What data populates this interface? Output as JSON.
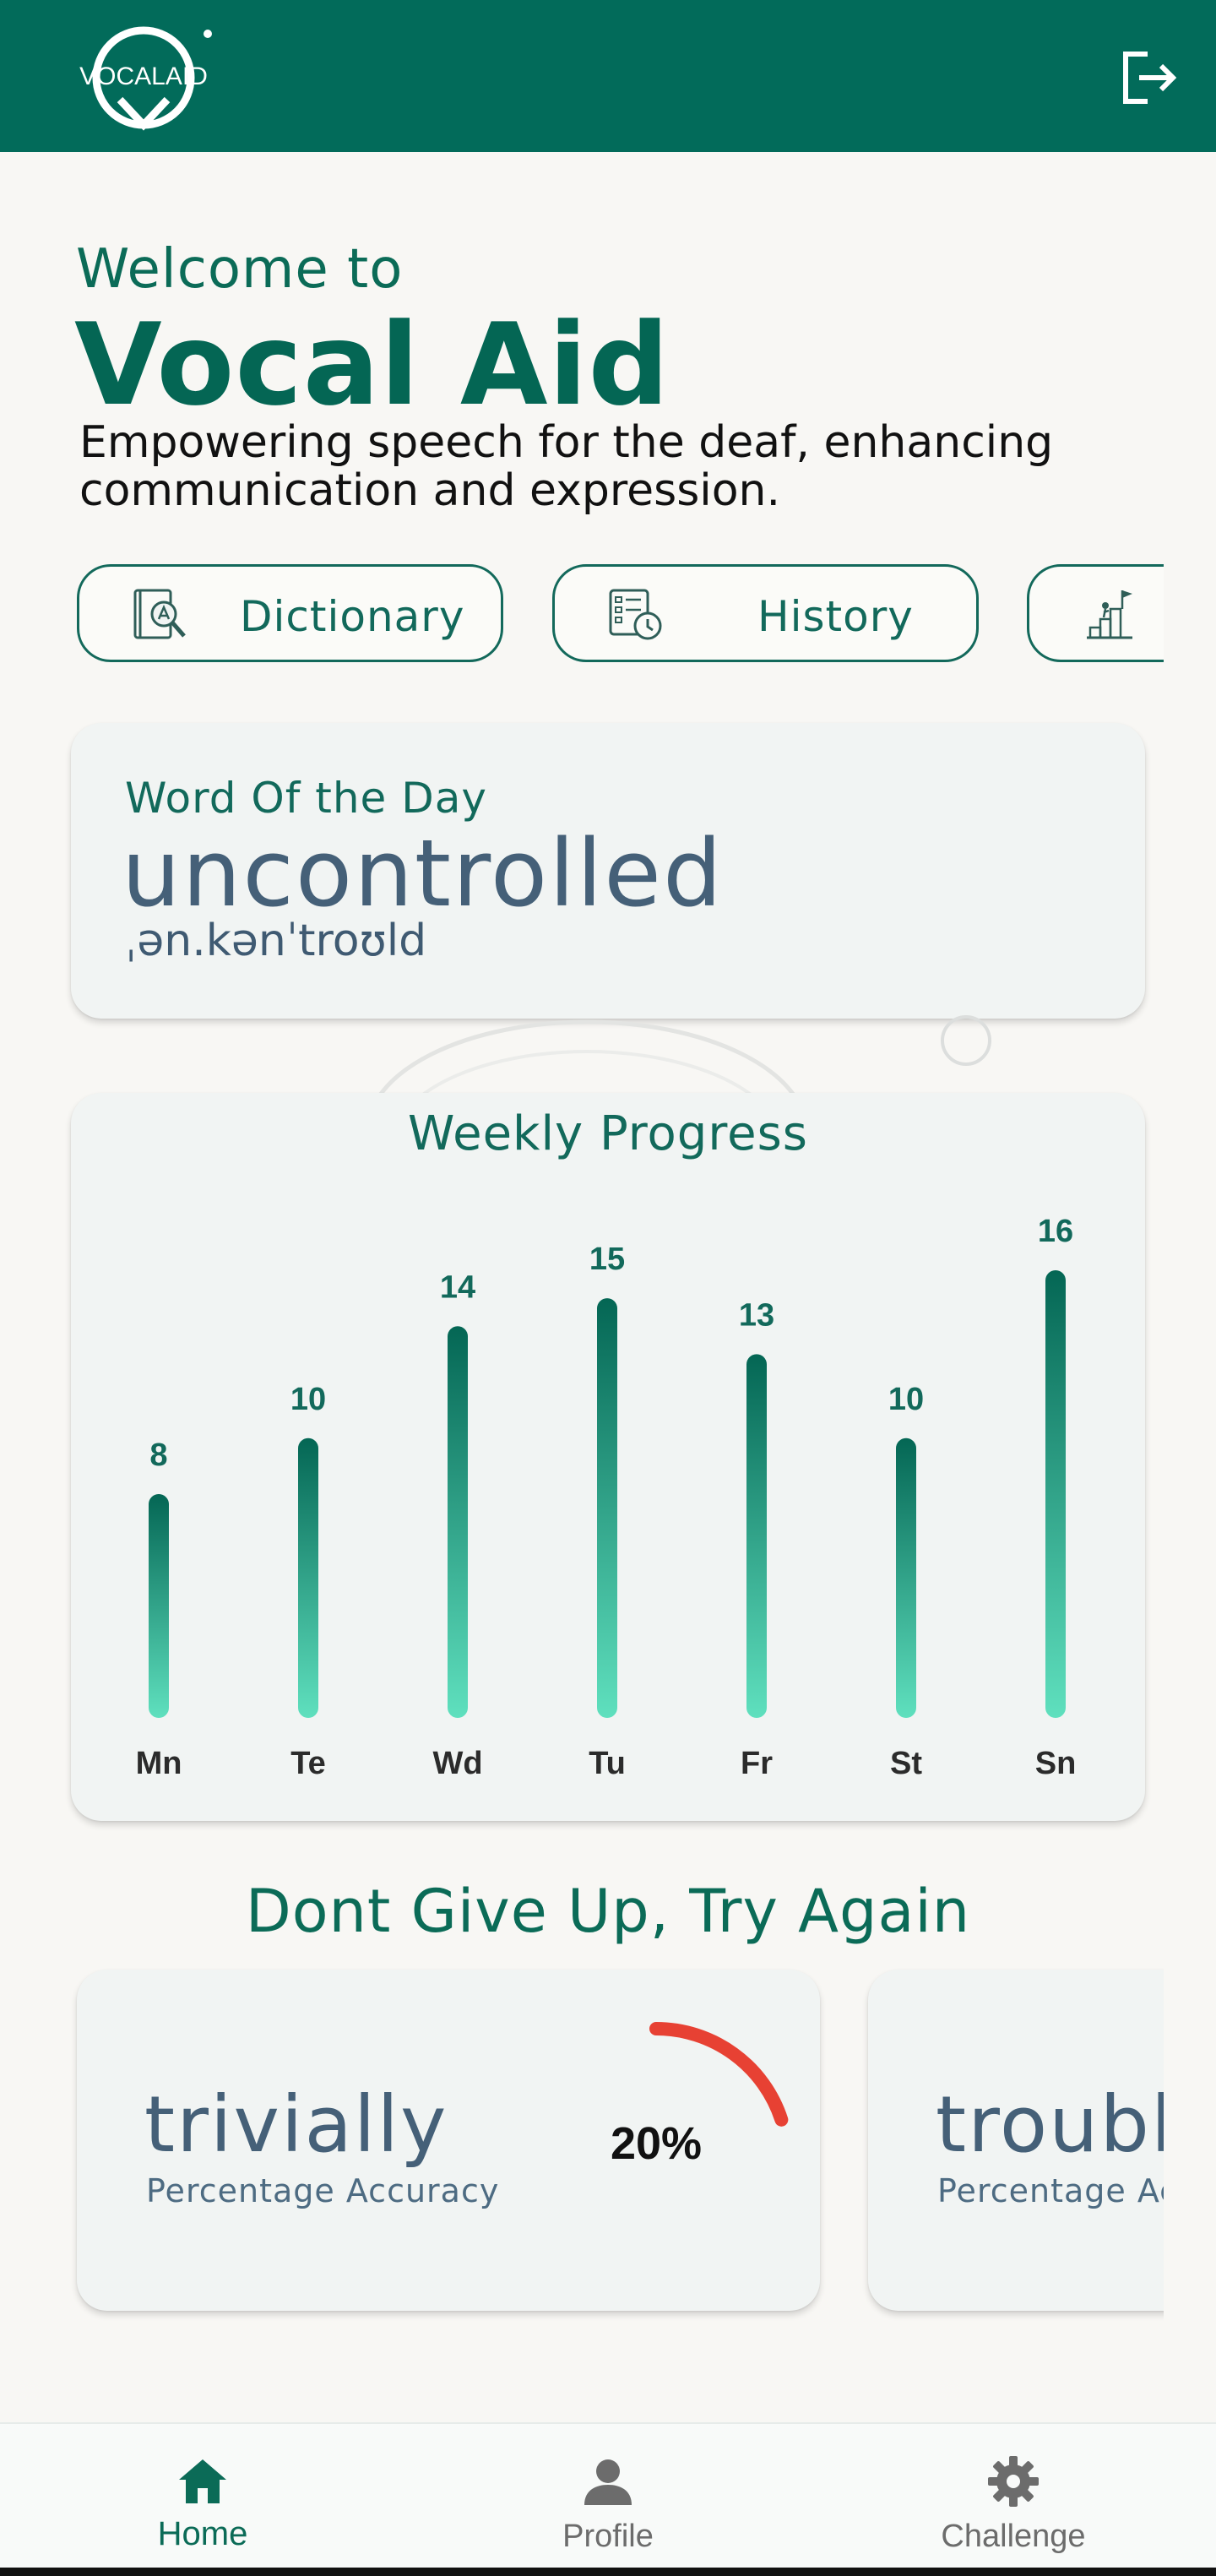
{
  "header": {
    "logo_text": "VOCALAID",
    "logout_icon": "logout-icon"
  },
  "hero": {
    "welcome": "Welcome to",
    "title": "Vocal Aid",
    "tagline": "Empowering speech for the deaf, enhancing communication and expression."
  },
  "quick_actions": [
    {
      "label": "Dictionary",
      "icon": "dictionary-icon"
    },
    {
      "label": "History",
      "icon": "history-icon"
    },
    {
      "label": "",
      "icon": "challenge-flag-icon"
    }
  ],
  "word_of_day": {
    "label": "Word Of the Day",
    "word": "uncontrolled",
    "phonetic": "ˌən.kənˈtroʊld"
  },
  "weekly_progress": {
    "title": "Weekly Progress",
    "chart_data": {
      "type": "bar",
      "categories": [
        "Mn",
        "Te",
        "Wd",
        "Tu",
        "Fr",
        "St",
        "Sn"
      ],
      "values": [
        8,
        10,
        14,
        15,
        13,
        10,
        16
      ],
      "ylim": [
        0,
        16
      ],
      "grid": false,
      "colors": {
        "top": "#046654",
        "bottom": "#5fe0be"
      }
    }
  },
  "retry": {
    "title": "Dont Give Up, Try Again",
    "cards": [
      {
        "word": "trivially",
        "subtitle": "Percentage Accuracy",
        "percent": "20%",
        "accuracy": 0.2
      },
      {
        "word": "trouble",
        "subtitle": "Percentage Acc",
        "percent": "",
        "accuracy": null
      }
    ],
    "gauge_color": "#e74133"
  },
  "bottom_nav": {
    "home": "Home",
    "profile": "Profile",
    "challenge": "Challenge",
    "active": "home",
    "active_color": "#0b6b57",
    "inactive_color": "#6c6c6c"
  }
}
